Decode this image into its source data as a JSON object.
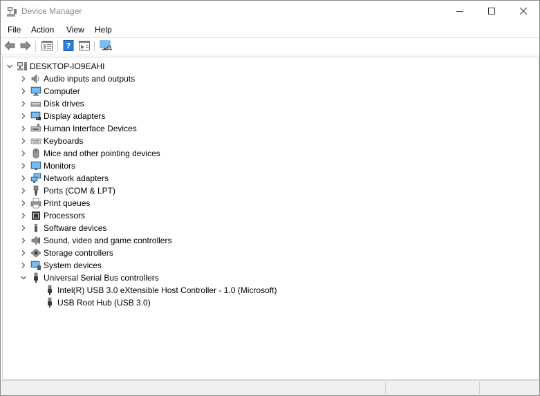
{
  "window": {
    "title": "Device Manager"
  },
  "caption": {
    "minimize": "minimize-icon",
    "maximize": "maximize-icon",
    "close": "close-icon"
  },
  "menu": [
    "File",
    "Action",
    "View",
    "Help"
  ],
  "toolbar": {
    "buttons": [
      "back-arrow-icon",
      "forward-arrow-icon",
      "properties-icon",
      "help-icon",
      "update-driver-icon",
      "scan-hardware-icon"
    ]
  },
  "tree": {
    "root": "DESKTOP-IO9EAHI",
    "categories": [
      "Audio inputs and outputs",
      "Computer",
      "Disk drives",
      "Display adapters",
      "Human Interface Devices",
      "Keyboards",
      "Mice and other pointing devices",
      "Monitors",
      "Network adapters",
      "Ports (COM & LPT)",
      "Print queues",
      "Processors",
      "Software devices",
      "Sound, video and game controllers",
      "Storage controllers",
      "System devices",
      "Universal Serial Bus controllers"
    ],
    "usb_children": [
      "Intel(R) USB 3.0 eXtensible Host Controller - 1.0 (Microsoft)",
      "USB Root Hub (USB 3.0)"
    ]
  },
  "colors": {
    "title_inactive": "#8a8a8a",
    "icon_blue": "#2b7fd4"
  }
}
